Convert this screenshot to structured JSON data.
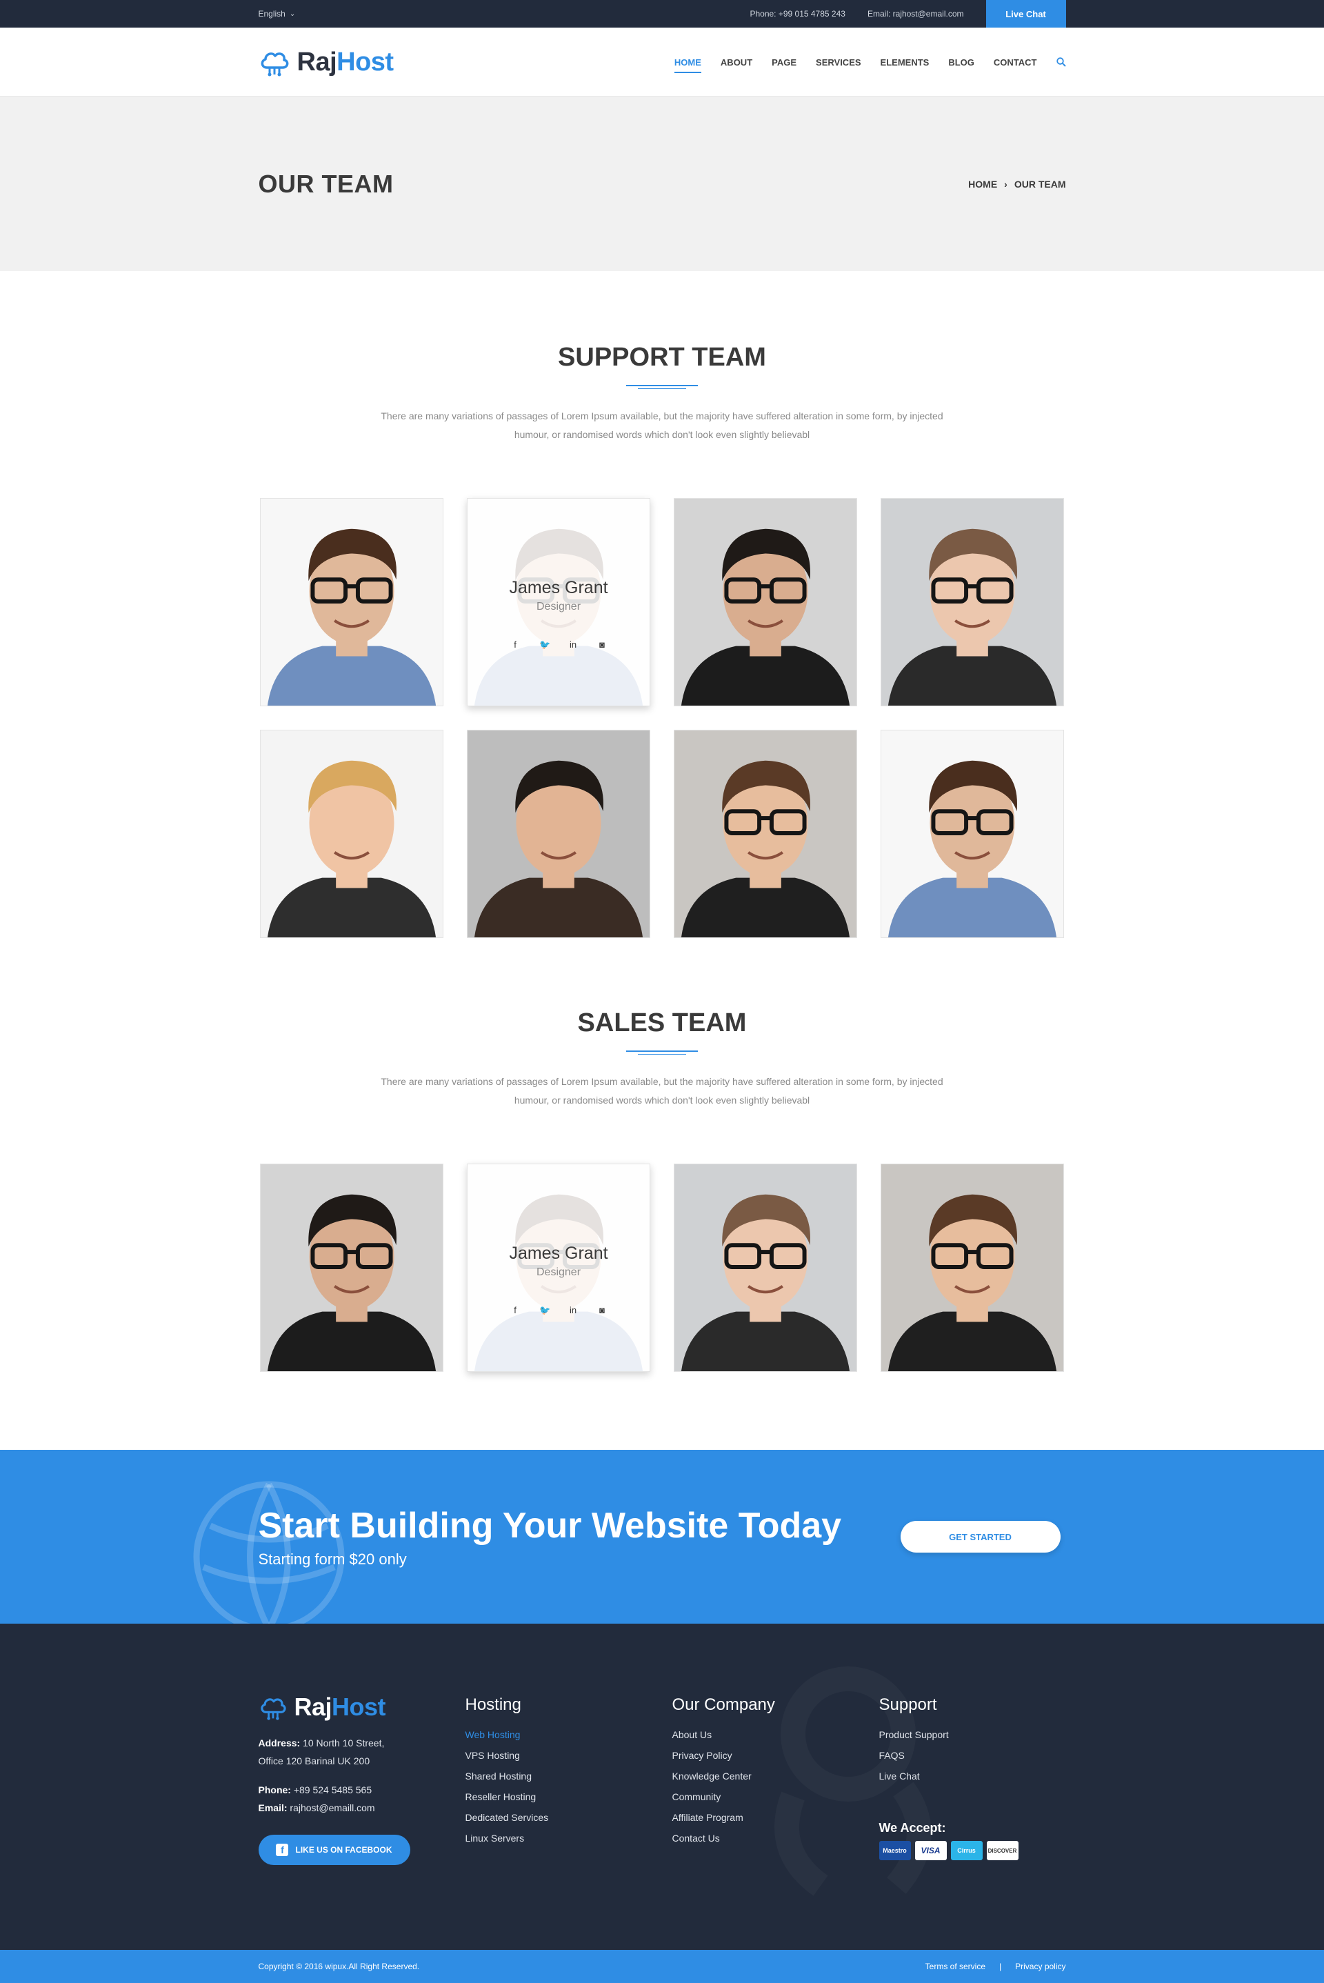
{
  "topbar": {
    "language": "English",
    "phone": "Phone: +99 015 4785 243",
    "email": "Email: rajhost@email.com",
    "live_chat": "Live Chat"
  },
  "brand": {
    "part1": "Raj",
    "part2": "Host"
  },
  "nav": {
    "items": [
      "HOME",
      "ABOUT",
      "PAGE",
      "SERVICES",
      "ELEMENTS",
      "BLOG",
      "CONTACT"
    ],
    "active": "HOME"
  },
  "page": {
    "title": "OUR TEAM",
    "breadcrumb": [
      "HOME",
      "OUR TEAM"
    ]
  },
  "support_team": {
    "title": "SUPPORT TEAM",
    "description": "There are many variations of passages of Lorem Ipsum available, but the majority have suffered alteration in some form, by injected humour, or randomised words which don't look even slightly believabl",
    "featured": {
      "name": "James Grant",
      "role": "Designer"
    }
  },
  "sales_team": {
    "title": "SALES TEAM",
    "description": "There are many variations of passages of Lorem Ipsum available, but the majority have suffered alteration in some form, by injected humour, or randomised words which don't look even slightly believabl",
    "featured": {
      "name": "James Grant",
      "role": "Designer"
    }
  },
  "cta": {
    "title": "Start Building Your Website Today",
    "subtitle": "Starting form $20 only",
    "button": "GET STARTED"
  },
  "footer": {
    "address_label": "Address:",
    "address_line1": "10 North 10 Street,",
    "address_line2": "Office 120 Barinal UK 200",
    "phone_label": "Phone:",
    "phone": "+89 524 5485 565",
    "email_label": "Email:",
    "email": "rajhost@emaill.com",
    "facebook_button": "LIKE US ON FACEBOOK",
    "hosting": {
      "title": "Hosting",
      "links": [
        "Web Hosting",
        "VPS Hosting",
        "Shared Hosting",
        "Reseller Hosting",
        "Dedicated Services",
        "Linux Servers"
      ]
    },
    "company": {
      "title": "Our Company",
      "links": [
        "About Us",
        "Privacy Policy",
        "Knowledge Center",
        "Community",
        "Affiliate Program",
        "Contact Us"
      ]
    },
    "support": {
      "title": "Support",
      "links": [
        "Product Support",
        "FAQS",
        "Live Chat"
      ]
    },
    "we_accept": "We Accept:",
    "payment_cards": [
      "Maestro",
      "VISA",
      "Cirrus",
      "DISCOVER"
    ]
  },
  "bottombar": {
    "copyright": "Copyright © 2016 wipux.All Right Reserved.",
    "terms": "Terms of service",
    "separator": "|",
    "privacy": "Privacy policy"
  },
  "colors": {
    "accent": "#2f8de4",
    "dark": "#222b3c",
    "band": "#f1f1f1"
  }
}
